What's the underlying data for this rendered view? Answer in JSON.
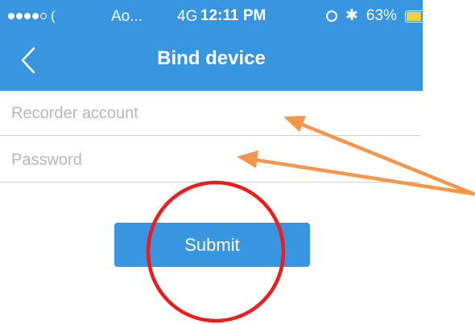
{
  "status_bar": {
    "carrier": "(",
    "carrier_name": "Аo...",
    "network": "4G",
    "time": "12:11 PM",
    "battery": "63%",
    "battery_level": 0.63,
    "battery_color": "#f7d12c",
    "icons": [
      "signal-dots-icon",
      "alarm-icon",
      "bluetooth-icon",
      "battery-icon"
    ]
  },
  "header": {
    "title": "Bind device",
    "back_icon": "chevron-left-icon",
    "background": "#3895e0"
  },
  "form": {
    "account_field": {
      "placeholder": "Recorder account",
      "value": ""
    },
    "password_field": {
      "placeholder": "Password",
      "value": ""
    },
    "submit_label": "Submit"
  },
  "annotations": {
    "arrow_color": "#f5964a",
    "circle_color": "#ee1c1c"
  }
}
